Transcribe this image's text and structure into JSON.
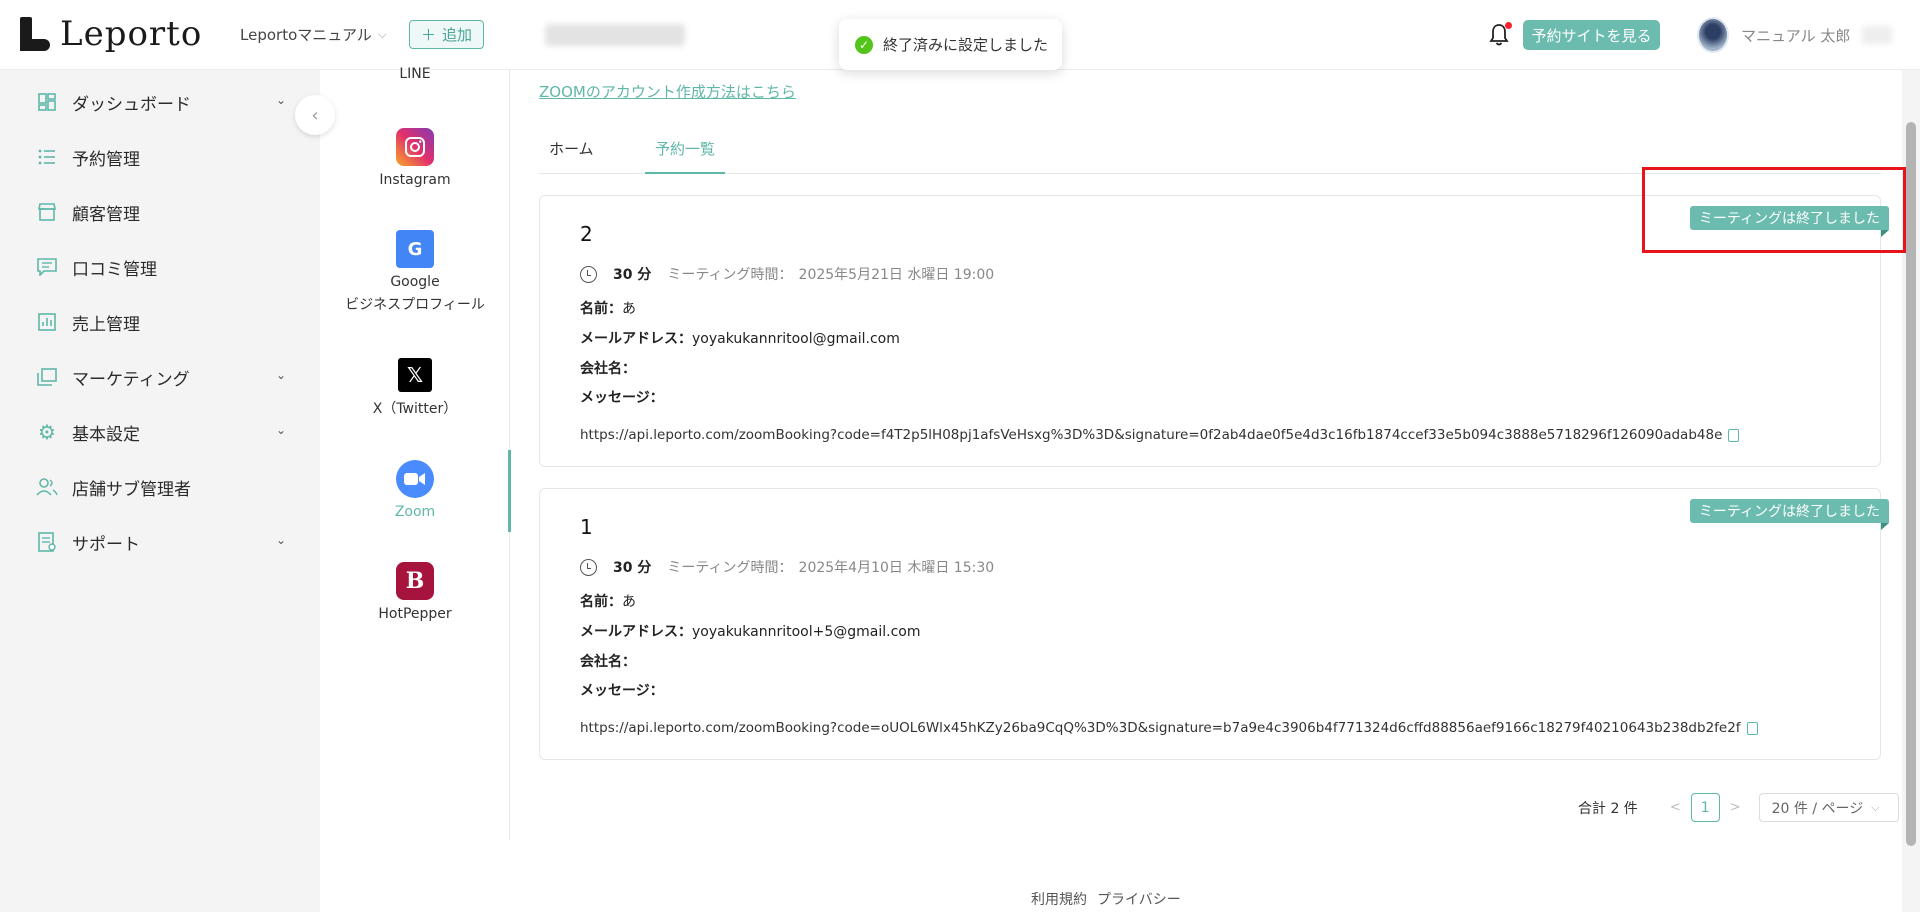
{
  "header": {
    "logo_text": "Leporto",
    "store_name": "Leportoマニュアル",
    "add_label": "追加",
    "toast_message": "終了済みに設定しました",
    "view_site_label": "予約サイトを見る",
    "user_name": "マニュアル 太郎"
  },
  "sidebar": {
    "items": [
      {
        "label": "ダッシュボード",
        "icon": "dashboard-icon",
        "expandable": true
      },
      {
        "label": "予約管理",
        "icon": "list-icon",
        "expandable": false
      },
      {
        "label": "顧客管理",
        "icon": "store-icon",
        "expandable": false
      },
      {
        "label": "口コミ管理",
        "icon": "comment-icon",
        "expandable": false
      },
      {
        "label": "売上管理",
        "icon": "sales-chart-icon",
        "expandable": false
      },
      {
        "label": "マーケティング",
        "icon": "marketing-icon",
        "expandable": true
      },
      {
        "label": "基本設定",
        "icon": "gear-icon",
        "expandable": true
      },
      {
        "label": "店舗サブ管理者",
        "icon": "users-icon",
        "expandable": false
      },
      {
        "label": "サポート",
        "icon": "support-icon",
        "expandable": true
      }
    ]
  },
  "channels": [
    {
      "label": "LINE",
      "icon": "line-icon"
    },
    {
      "label": "Instagram",
      "icon": "instagram-icon"
    },
    {
      "label": "Google",
      "label2": "ビジネスプロフィール",
      "icon": "google-business-icon"
    },
    {
      "label": "X（Twitter）",
      "icon": "x-twitter-icon"
    },
    {
      "label": "Zoom",
      "icon": "zoom-icon",
      "active": true
    },
    {
      "label": "HotPepper",
      "icon": "hotpepper-icon"
    }
  ],
  "main": {
    "zoom_link": "ZOOMのアカウント作成方法はこちら",
    "tabs": [
      {
        "label": "ホーム"
      },
      {
        "label": "予約一覧",
        "active": true
      }
    ],
    "bookings": [
      {
        "number": "2",
        "duration": "30 分",
        "meeting_label": "ミーティング時間：",
        "meeting_time": "2025年5月21日 水曜日 19:00",
        "name_label": "名前：",
        "name": "あ",
        "email_label": "メールアドレス：",
        "email": "yoyakukannritool@gmail.com",
        "company_label": "会社名：",
        "company": "",
        "message_label": "メッセージ：",
        "message": "",
        "url": "https://api.leporto.com/zoomBooking?code=f4T2p5lH08pj1afsVeHsxg%3D%3D&signature=0f2ab4dae0f5e4d3c16fb1874ccef33e5b094c3888e5718296f126090adab48e",
        "status": "ミーティングは終了しました"
      },
      {
        "number": "1",
        "duration": "30 分",
        "meeting_label": "ミーティング時間：",
        "meeting_time": "2025年4月10日 木曜日 15:30",
        "name_label": "名前：",
        "name": "あ",
        "email_label": "メールアドレス：",
        "email": "yoyakukannritool+5@gmail.com",
        "company_label": "会社名：",
        "company": "",
        "message_label": "メッセージ：",
        "message": "",
        "url": "https://api.leporto.com/zoomBooking?code=oUOL6Wlx45hKZy26ba9CqQ%3D%3D&signature=b7a9e4c3906b4f771324d6cffd88856aef9166c18279f40210643b238db2fe2f",
        "status": "ミーティングは終了しました"
      }
    ]
  },
  "pagination": {
    "total": "合計 2 件",
    "current_page": "1",
    "page_size": "20 件 / ページ"
  },
  "footer": {
    "terms": "利用規約",
    "privacy": "プライバシー"
  },
  "colors": {
    "accent": "#5fb7a8",
    "badge": "#6bbcae",
    "highlight": "#e8141b",
    "toast_success": "#52c41a"
  }
}
